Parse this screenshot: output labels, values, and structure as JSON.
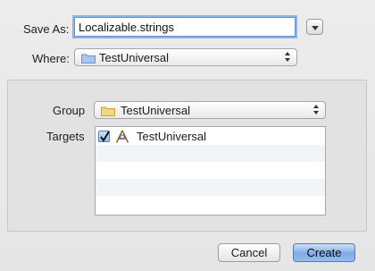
{
  "save_as": {
    "label": "Save As:",
    "value": "Localizable.strings"
  },
  "where": {
    "label": "Where:",
    "selected": "TestUniversal",
    "icon": "folder-icon"
  },
  "group": {
    "label": "Group",
    "selected": "TestUniversal",
    "icon": "folder-icon"
  },
  "targets": {
    "label": "Targets",
    "items": [
      {
        "name": "TestUniversal",
        "checked": true,
        "icon": "app-target-icon"
      }
    ]
  },
  "buttons": {
    "cancel": "Cancel",
    "create": "Create"
  },
  "colors": {
    "accent": "#7eaae6",
    "focus_ring": "#8db3ec",
    "folder": "#a9c7ec"
  }
}
